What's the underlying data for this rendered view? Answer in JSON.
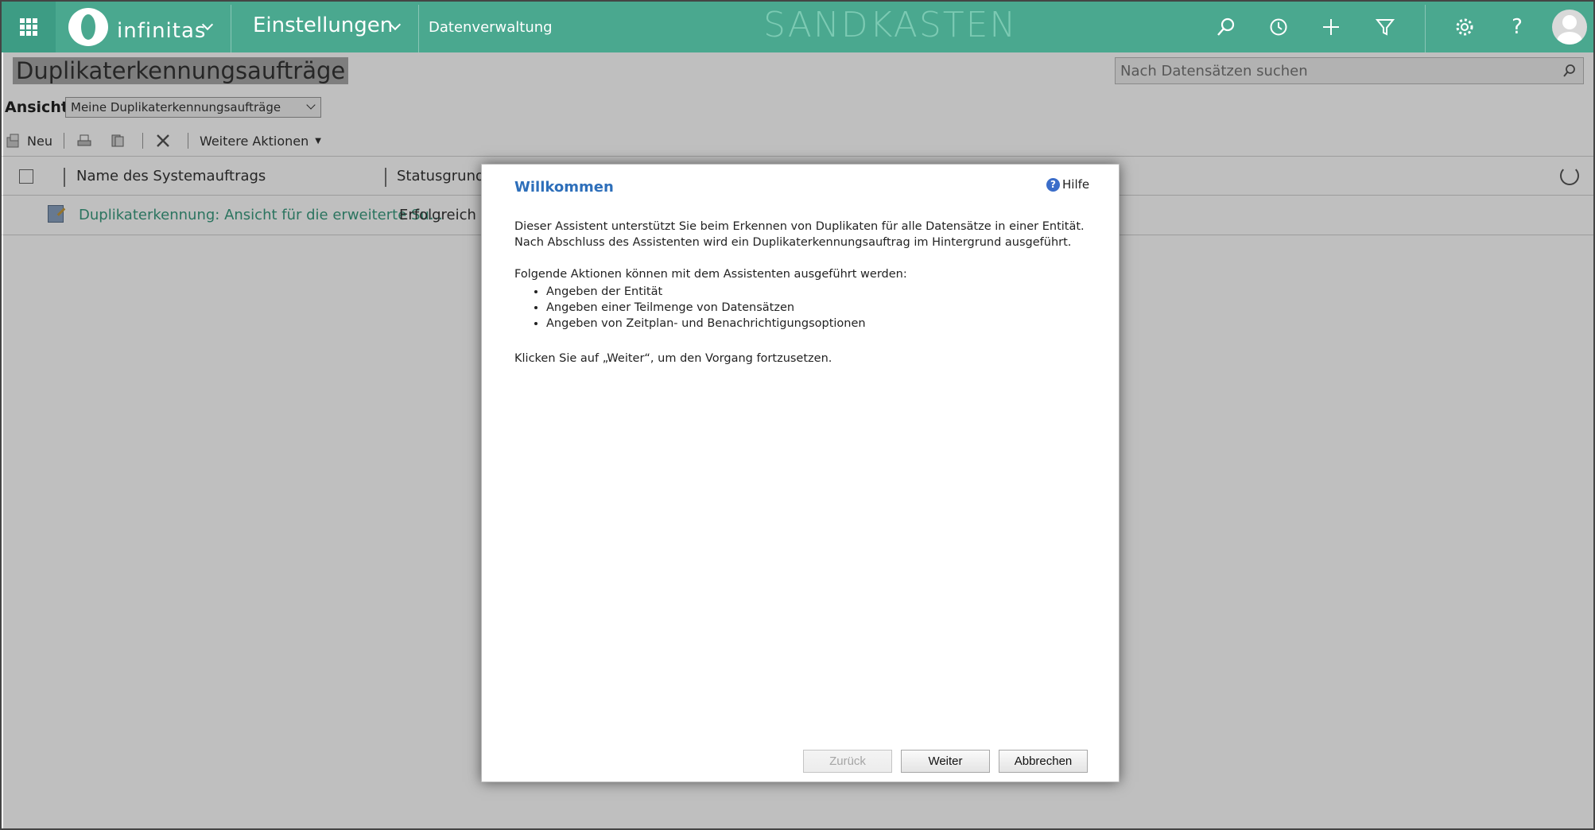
{
  "nav": {
    "brand": "infinitas",
    "area": "Einstellungen",
    "breadcrumb": "Datenverwaltung",
    "environment": "SANDKASTEN",
    "accent_color": "#4aa88f",
    "icons": [
      "search-icon",
      "history-icon",
      "plus-icon",
      "filter-icon",
      "gear-icon",
      "help-icon",
      "user-avatar"
    ]
  },
  "page": {
    "title": "Duplikaterkennungsaufträge",
    "search_placeholder": "Nach Datensätzen suchen",
    "view_label": "Ansicht:",
    "view_selected": "Meine Duplikaterkennungsaufträge"
  },
  "commands": {
    "new_label": "Neu",
    "more_actions_label": "Weitere Aktionen"
  },
  "grid": {
    "columns": [
      "Name des Systemauftrags",
      "Statusgrund"
    ],
    "rows": [
      {
        "name": "Duplikaterkennung: Ansicht für die erweiterte Su...",
        "status": "Erfolgreich"
      }
    ]
  },
  "dialog": {
    "title": "Willkommen",
    "help_label": "Hilfe",
    "intro": "Dieser Assistent unterstützt Sie beim Erkennen von Duplikaten für alle Datensätze in einer Entität. Nach Abschluss des Assistenten wird ein Duplikaterkennungsauftrag im Hintergrund ausgeführt.",
    "actions_heading": "Folgende Aktionen können mit dem Assistenten ausgeführt werden:",
    "actions": [
      "Angeben der Entität",
      "Angeben einer Teilmenge von Datensätzen",
      "Angeben von Zeitplan- und Benachrichtigungsoptionen"
    ],
    "continue_hint": "Klicken Sie auf „Weiter“, um den Vorgang fortzusetzen.",
    "buttons": {
      "back": "Zurück",
      "next": "Weiter",
      "cancel": "Abbrechen"
    }
  }
}
